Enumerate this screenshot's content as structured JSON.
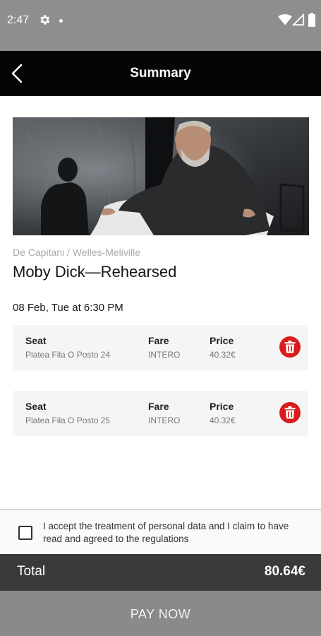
{
  "status_bar": {
    "time": "2:47",
    "icons": [
      "gear-icon",
      "dot-icon",
      "wifi-icon",
      "signal-icon",
      "battery-icon"
    ]
  },
  "app_bar": {
    "back_icon": "chevron-left-icon",
    "title": "Summary"
  },
  "event": {
    "image": "stage-performance-photo",
    "author": "De Capitani / Welles-Meliville",
    "title": "Moby Dick—Rehearsed",
    "date": "08 Feb, Tue at 6:30 PM"
  },
  "ticket_labels": {
    "seat": "Seat",
    "fare": "Fare",
    "price": "Price"
  },
  "tickets": [
    {
      "seat": "Platea Fila O Posto 24",
      "fare": "INTERO",
      "price": "40.32€"
    },
    {
      "seat": "Platea Fila O Posto 25",
      "fare": "INTERO",
      "price": "40.32€"
    }
  ],
  "consent": {
    "checked": false,
    "text": "I accept the treatment of personal data and I claim to have read and agreed to the regulations"
  },
  "total": {
    "label": "Total",
    "amount": "80.64€"
  },
  "pay_button": {
    "label": "PAY NOW"
  },
  "colors": {
    "status_bar": "#8e8e8e",
    "app_bar": "#050505",
    "delete_accent": "#d81b1b",
    "total_bar": "#3a3a3a",
    "pay_button": "#8a8a8a"
  }
}
